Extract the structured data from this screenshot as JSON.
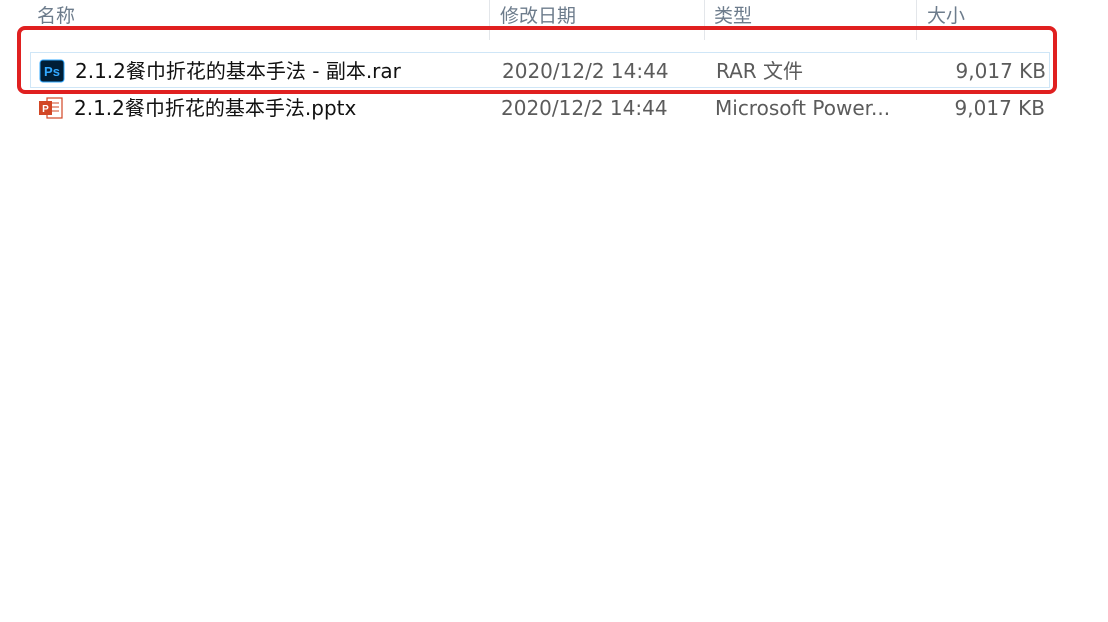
{
  "columns": {
    "name": "名称",
    "date": "修改日期",
    "type": "类型",
    "size": "大小"
  },
  "files": [
    {
      "name": "2.1.2餐巾折花的基本手法 - 副本.rar",
      "date": "2020/12/2 14:44",
      "type": "RAR 文件",
      "size": "9,017 KB",
      "icon": "photoshop-icon",
      "selected": true
    },
    {
      "name": "2.1.2餐巾折花的基本手法.pptx",
      "date": "2020/12/2 14:44",
      "type": "Microsoft Power...",
      "size": "9,017 KB",
      "icon": "powerpoint-icon",
      "selected": false
    }
  ],
  "colors": {
    "highlight": "#e02020",
    "photoshop_bg": "#001e36",
    "photoshop_fg": "#31a8ff",
    "powerpoint": "#d24726"
  }
}
